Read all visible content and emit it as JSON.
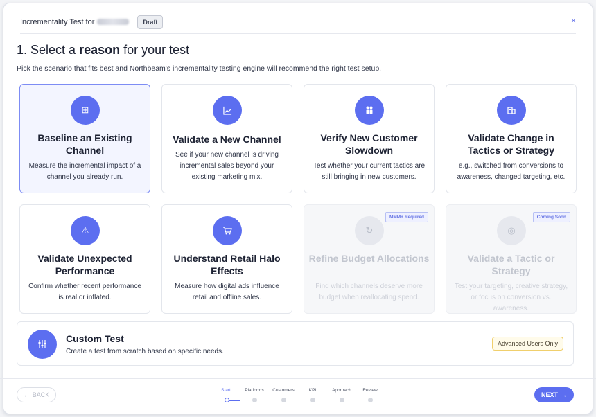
{
  "header": {
    "title": "Incrementality Test for",
    "badge": "Draft",
    "close": "×"
  },
  "page": {
    "title_prefix": "1. Select a ",
    "title_bold": "reason",
    "title_suffix": " for your test",
    "subtitle": "Pick the scenario that fits best and Northbeam's incrementality testing engine will recommend the right test setup."
  },
  "cards": [
    {
      "title": "Baseline an Existing Channel",
      "desc": "Measure the incremental impact of a channel you already run.",
      "icon": "grid-icon",
      "glyph": "⊞"
    },
    {
      "title": "Validate a New Channel",
      "desc": "See if your new channel is driving incremental sales beyond your existing marketing mix.",
      "icon": "chart-line-icon",
      "glyph": "📈"
    },
    {
      "title": "Verify New Customer Slowdown",
      "desc": "Test whether your current tactics are still bringing in new customers.",
      "icon": "people-icon",
      "glyph": "👥"
    },
    {
      "title": "Validate Change in Tactics or Strategy",
      "desc": "e.g., switched from conversions to awareness, changed targeting, etc.",
      "icon": "building-icon",
      "glyph": "▦"
    },
    {
      "title": "Validate Unexpected Performance",
      "desc": "Confirm whether recent performance is real or inflated.",
      "icon": "warning-icon",
      "glyph": "⚠"
    },
    {
      "title": "Understand Retail Halo Effects",
      "desc": "Measure how digital ads influence retail and offline sales.",
      "icon": "cart-icon",
      "glyph": "🛒"
    },
    {
      "title": "Refine Budget Allocations",
      "desc": "Find which channels deserve more budget when reallocating spend.",
      "icon": "refresh-icon",
      "glyph": "↻",
      "tag": "MMM+ Required"
    },
    {
      "title": "Validate a Tactic or Strategy",
      "desc": "Test your targeting, creative strategy, or focus on conversion vs. awareness.",
      "icon": "target-icon",
      "glyph": "◎",
      "tag": "Coming Soon"
    }
  ],
  "custom": {
    "title": "Custom Test",
    "desc": "Create a test from scratch based on specific needs.",
    "badge": "Advanced Users Only",
    "icon": "sliders-icon",
    "glyph": "⫶"
  },
  "footer": {
    "back_label": "BACK",
    "back_arrow": "←",
    "next_label": "NEXT",
    "next_arrow": "→",
    "steps": [
      "Start",
      "Platforms",
      "Customers",
      "KPI",
      "Approach",
      "Review"
    ],
    "current_step": 1
  },
  "colors": {
    "accent": "#5c6ef0",
    "selected_border": "#7d8cf4",
    "advanced_border": "#f0cf6c"
  }
}
